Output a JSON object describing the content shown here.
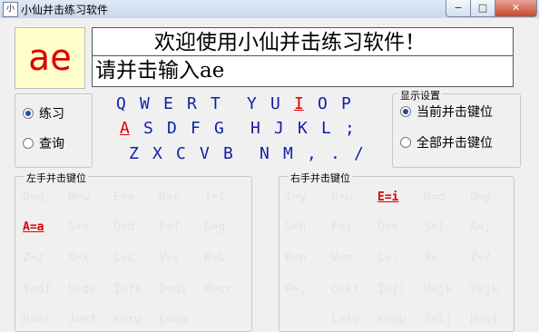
{
  "window": {
    "title": "小仙并击练习软件",
    "icon": "app-icon",
    "icon_glyph": "小",
    "min_glyph": "−",
    "max_glyph": "□",
    "close_glyph": "✕"
  },
  "display": {
    "current_key": "ae",
    "welcome": "欢迎使用小仙并击练习软件！",
    "prompt": "请并击输入ae"
  },
  "mode": {
    "options": [
      {
        "label": "练习",
        "selected": true
      },
      {
        "label": "查询",
        "selected": false
      }
    ]
  },
  "keyboard": {
    "rows": [
      [
        "Q",
        "W",
        "E",
        "R",
        "T",
        "Y",
        "U",
        "I",
        "O",
        "P"
      ],
      [
        "A",
        "S",
        "D",
        "F",
        "G",
        "H",
        "J",
        "K",
        "L",
        ";"
      ],
      [
        "Z",
        "X",
        "C",
        "V",
        "B",
        "N",
        "M",
        ",",
        ".",
        "/"
      ]
    ],
    "highlighted": [
      "A",
      "I"
    ]
  },
  "display_settings": {
    "title": "显示设置",
    "options": [
      {
        "label": "当前并击键位",
        "selected": true
      },
      {
        "label": "全部并击键位",
        "selected": false
      }
    ]
  },
  "left_hand": {
    "title": "左手并击键位",
    "combos": [
      [
        "Q=q",
        "W=w",
        "E=e",
        "R=r",
        "T=t"
      ],
      [
        "A=a",
        "S=s",
        "D=d",
        "F=f",
        "G=g"
      ],
      [
        "Z=z",
        "X=x",
        "C=c",
        "V=v",
        "B=b"
      ],
      [
        "Y=df",
        "U=dv",
        "I=fs",
        "D=ds",
        "P=cr"
      ],
      [
        "H=er",
        "J=ef",
        "K=rw",
        "L=ew"
      ]
    ],
    "highlighted": "A=a"
  },
  "right_hand": {
    "title": "右手并击键位",
    "combos": [
      [
        "T=y",
        "R=u",
        "E=i",
        "W=o",
        "Q=p"
      ],
      [
        "G=h",
        "F=j",
        "D=k",
        "S=l",
        "A=;"
      ],
      [
        "B=n",
        "V=m",
        "C=,",
        "X=.",
        "Z=/"
      ],
      [
        "P=,.",
        "O=kl",
        "I=jl",
        "U=jk",
        "Y=jk"
      ],
      [
        "L=io",
        "K=ou",
        "J=ij",
        "H=ui"
      ]
    ],
    "highlighted": "E=i"
  },
  "colors": {
    "key_text": "#0f1fa8",
    "highlight": "#e00000",
    "key_display_bg": "#ffffcc",
    "inactive_combo": "#e2e2e2"
  }
}
